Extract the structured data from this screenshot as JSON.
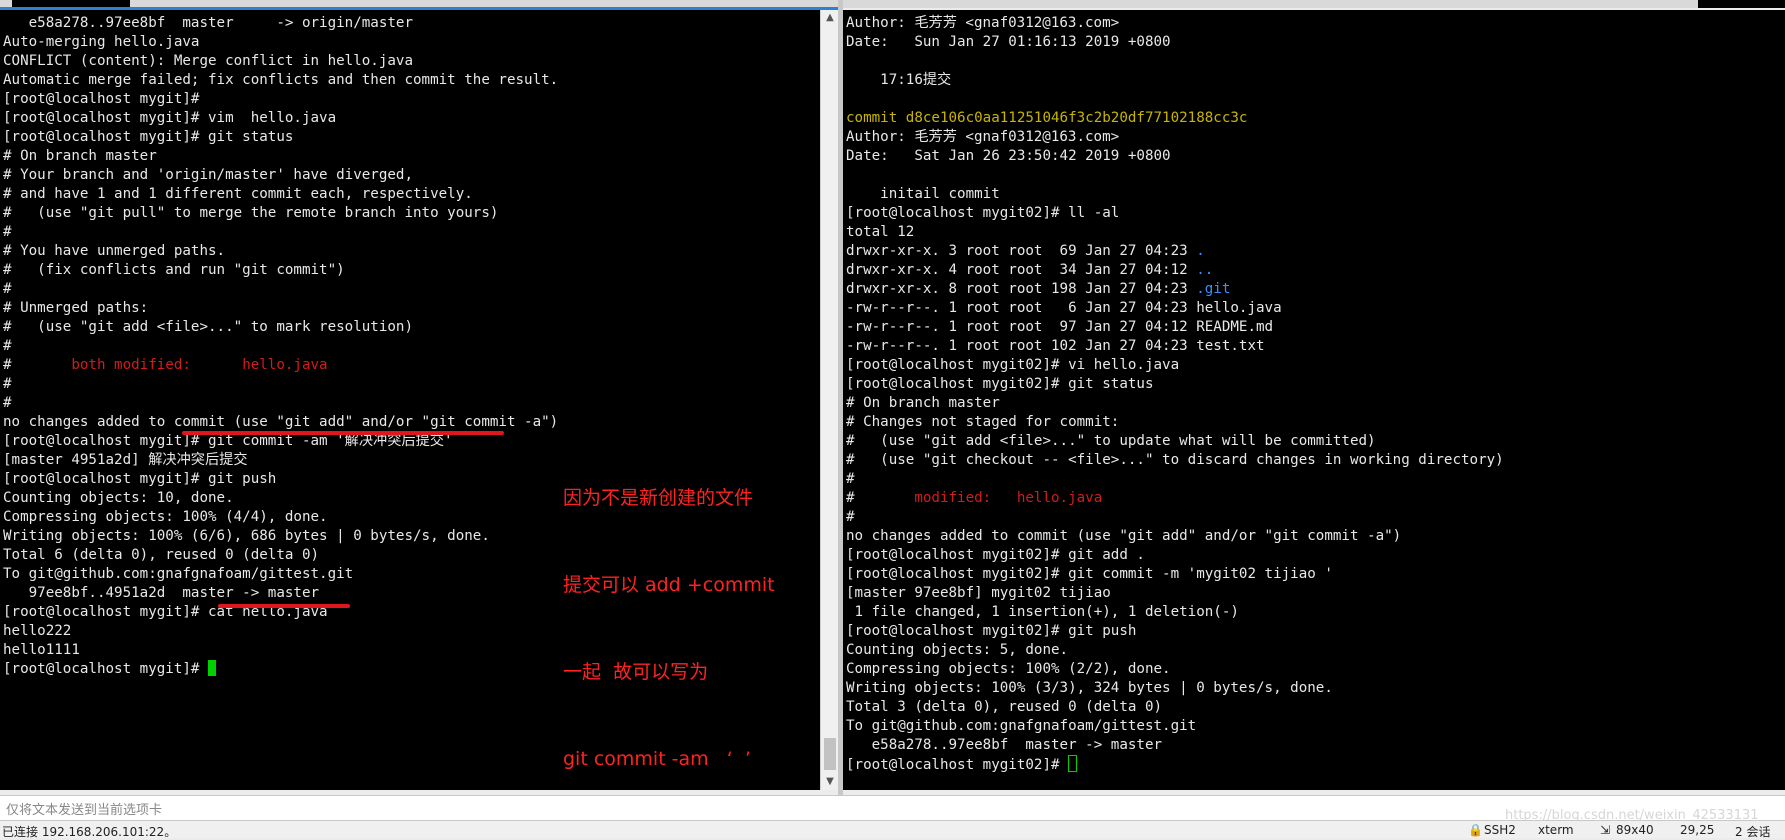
{
  "colors": {
    "conflict_red": "#d11c1c",
    "commit_yellow": "#c8b400",
    "dir_blue": "#3b8fff",
    "annotation_red": "#ff2222",
    "cursor_green": "#00d000"
  },
  "left_terminal": {
    "lines": [
      "   e58a278..97ee8bf  master     -> origin/master",
      "Auto-merging hello.java",
      "CONFLICT (content): Merge conflict in hello.java",
      "Automatic merge failed; fix conflicts and then commit the result.",
      "[root@localhost mygit]#",
      "[root@localhost mygit]# vim  hello.java",
      "[root@localhost mygit]# git status",
      "# On branch master",
      "# Your branch and 'origin/master' have diverged,",
      "# and have 1 and 1 different commit each, respectively.",
      "#   (use \"git pull\" to merge the remote branch into yours)",
      "#",
      "# You have unmerged paths.",
      "#   (fix conflicts and run \"git commit\")",
      "#",
      "# Unmerged paths:",
      "#   (use \"git add <file>...\" to mark resolution)",
      "#",
      "#",
      "#",
      "no changes added to commit (use \"git add\" and/or \"git commit -a\")",
      "[root@localhost mygit]# git commit -am '解决冲突后提交'",
      "[master 4951a2d] 解决冲突后提交",
      "[root@localhost mygit]# git push",
      "Counting objects: 10, done.",
      "Compressing objects: 100% (4/4), done.",
      "Writing objects: 100% (6/6), 686 bytes | 0 bytes/s, done.",
      "Total 6 (delta 0), reused 0 (delta 0)",
      "To git@github.com:gnafgnafoam/gittest.git",
      "   97ee8bf..4951a2d  master -> master",
      "[root@localhost mygit]# cat hello.java",
      "hello222",
      "hello1111",
      "[root@localhost mygit]# "
    ],
    "conflict_line": {
      "prefix": "#       ",
      "label": "both modified:",
      "spacer": "      ",
      "file": "hello.java"
    }
  },
  "right_terminal": {
    "lines": [
      "Author: 毛芳芳 <gnaf0312@163.com>",
      "Date:   Sun Jan 27 01:16:13 2019 +0800",
      "",
      "    17:16提交",
      "",
      "commit d8ce106c0aa11251046f3c2b20df77102188cc3c",
      "Author: 毛芳芳 <gnaf0312@163.com>",
      "Date:   Sat Jan 26 23:50:42 2019 +0800",
      "",
      "    initail commit",
      "[root@localhost mygit02]# ll -al",
      "total 12",
      "drwxr-xr-x. 3 root root  69 Jan 27 04:23 .",
      "drwxr-xr-x. 4 root root  34 Jan 27 04:12 ..",
      "drwxr-xr-x. 8 root root 198 Jan 27 04:23 .git",
      "-rw-r--r--. 1 root root   6 Jan 27 04:23 hello.java",
      "-rw-r--r--. 1 root root  97 Jan 27 04:12 README.md",
      "-rw-r--r--. 1 root root 102 Jan 27 04:23 test.txt",
      "[root@localhost mygit02]# vi hello.java",
      "[root@localhost mygit02]# git status",
      "# On branch master",
      "# Changes not staged for commit:",
      "#   (use \"git add <file>...\" to update what will be committed)",
      "#   (use \"git checkout -- <file>...\" to discard changes in working directory)",
      "#",
      "#",
      "#",
      "no changes added to commit (use \"git add\" and/or \"git commit -a\")",
      "[root@localhost mygit02]# git add .",
      "[root@localhost mygit02]# git commit -m 'mygit02 tijiao '",
      "[master 97ee8bf] mygit02 tijiao",
      " 1 file changed, 1 insertion(+), 1 deletion(-)",
      "[root@localhost mygit02]# git push",
      "Counting objects: 5, done.",
      "Compressing objects: 100% (2/2), done.",
      "Writing objects: 100% (3/3), 324 bytes | 0 bytes/s, done.",
      "Total 3 (delta 0), reused 0 (delta 0)",
      "To git@github.com:gnafgnafoam/gittest.git",
      "   e58a278..97ee8bf  master -> master",
      "[root@localhost mygit02]# "
    ],
    "modified_line": {
      "prefix": "#       ",
      "label": "modified:",
      "spacer": "   ",
      "file": "hello.java"
    }
  },
  "annotation": {
    "lines": [
      "因为不是新创建的文件",
      "提交可以 add +commit",
      "一起  故可以写为",
      "git commit -am   ‘  ’"
    ]
  },
  "input_bar": {
    "placeholder": "仅将文本发送到当前选项卡"
  },
  "status_bar": {
    "connection": "已连接 192.168.206.101:22。",
    "protocol": "SSH2",
    "terminal_type": "xterm",
    "size": "89x40",
    "cursor_pos": "29,25",
    "sessions": "2 会话"
  },
  "watermark": "https://blog.csdn.net/weixin_42533131",
  "icons": {
    "scroll_up": "up-arrow-icon",
    "scroll_down": "down-arrow-icon",
    "lock": "lock-icon",
    "resize": "resize-icon"
  }
}
